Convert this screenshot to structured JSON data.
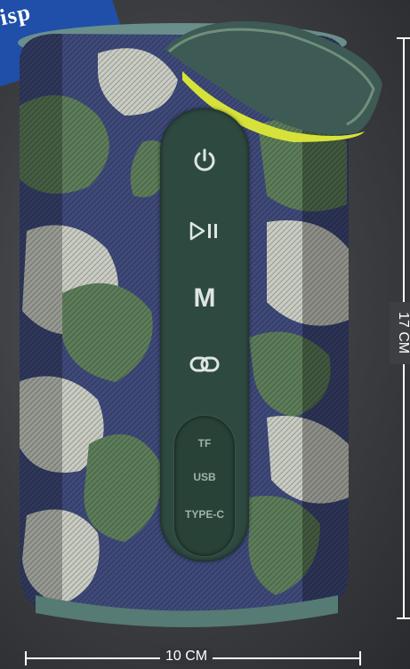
{
  "banner": {
    "text": "isp"
  },
  "buttons": {
    "power_icon": "power-icon",
    "play_pause_icon": "play-pause-icon",
    "mode_label": "M",
    "link_icon": "link-icon"
  },
  "ports": {
    "tf": "TF",
    "usb": "USB",
    "typec": "TYPE-C"
  },
  "dimensions": {
    "height": "17 CM",
    "width": "10 CM"
  },
  "colors": {
    "panel": "#2e4a40",
    "banner": "#1f4fa8",
    "strap_accent": "#d6e23a",
    "camo_navy": "#3f4a7a",
    "camo_green": "#5d7d5a",
    "camo_light": "#c9ccc2"
  }
}
